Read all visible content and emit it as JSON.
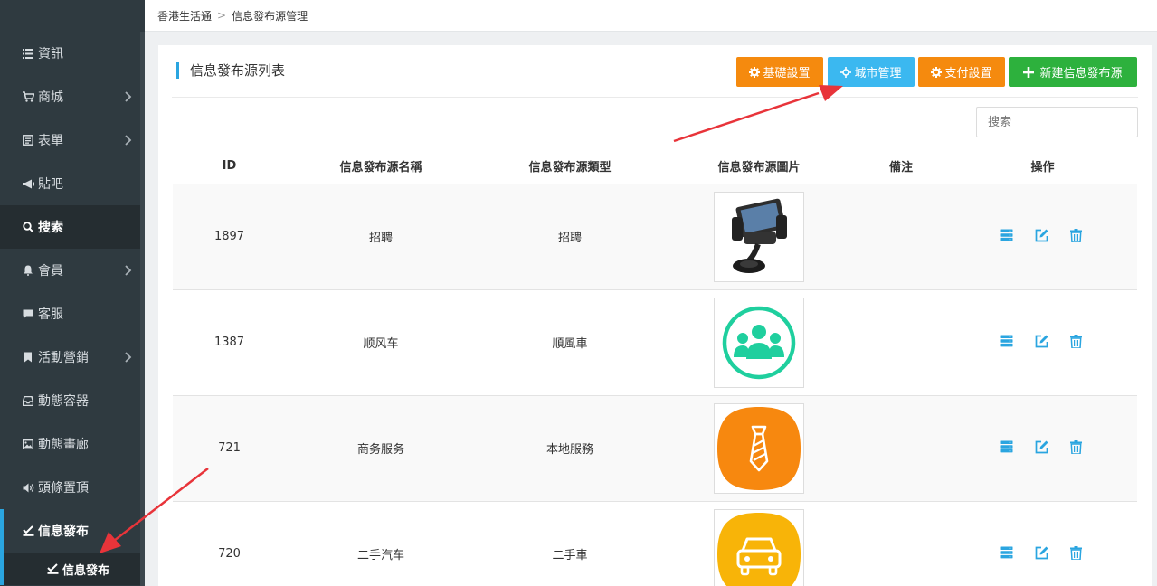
{
  "breadcrumb": {
    "root": "香港生活通",
    "separator": ">",
    "current": "信息發布源管理"
  },
  "sidebar": {
    "items": [
      {
        "label": "資訊",
        "icon": "list-icon",
        "chevron": false
      },
      {
        "label": "商城",
        "icon": "cart-icon",
        "chevron": true
      },
      {
        "label": "表單",
        "icon": "form-icon",
        "chevron": true
      },
      {
        "label": "貼吧",
        "icon": "megaphone-icon",
        "chevron": false
      },
      {
        "label": "搜索",
        "icon": "search-icon",
        "chevron": false
      },
      {
        "label": "會員",
        "icon": "bell-icon",
        "chevron": true
      },
      {
        "label": "客服",
        "icon": "chat-icon",
        "chevron": false
      },
      {
        "label": "活動營銷",
        "icon": "bookmark-icon",
        "chevron": true
      },
      {
        "label": "動態容器",
        "icon": "inbox-icon",
        "chevron": false
      },
      {
        "label": "動態畫廊",
        "icon": "image-icon",
        "chevron": false
      },
      {
        "label": "頭條置頂",
        "icon": "volume-icon",
        "chevron": false
      },
      {
        "label": "信息發布",
        "icon": "edit-check-icon",
        "chevron": false
      }
    ],
    "sub_item": "信息發布"
  },
  "panel": {
    "title": "信息發布源列表",
    "buttons": {
      "basic": "基礎設置",
      "city": "城市管理",
      "pay": "支付設置",
      "new": "新建信息發布源"
    },
    "search_placeholder": "搜索"
  },
  "table": {
    "headers": [
      "ID",
      "信息發布源名稱",
      "信息發布源類型",
      "信息發布源圖片",
      "備注",
      "操作"
    ],
    "rows": [
      {
        "id": "1897",
        "name": "招聘",
        "type": "招聘",
        "image": "phone-holder-image",
        "note": ""
      },
      {
        "id": "1387",
        "name": "顺风车",
        "type": "順風車",
        "image": "group-people-icon",
        "note": ""
      },
      {
        "id": "721",
        "name": "商务服务",
        "type": "本地服務",
        "image": "tie-icon",
        "note": ""
      },
      {
        "id": "720",
        "name": "二手汽车",
        "type": "二手車",
        "image": "car-icon",
        "note": ""
      }
    ]
  },
  "colors": {
    "sidebar_bg": "#2f3a40",
    "accent": "#2aa5e0",
    "orange": "#f58a0e",
    "blue": "#3bb8f0",
    "green": "#2db13d",
    "arrow": "#e8343a"
  }
}
